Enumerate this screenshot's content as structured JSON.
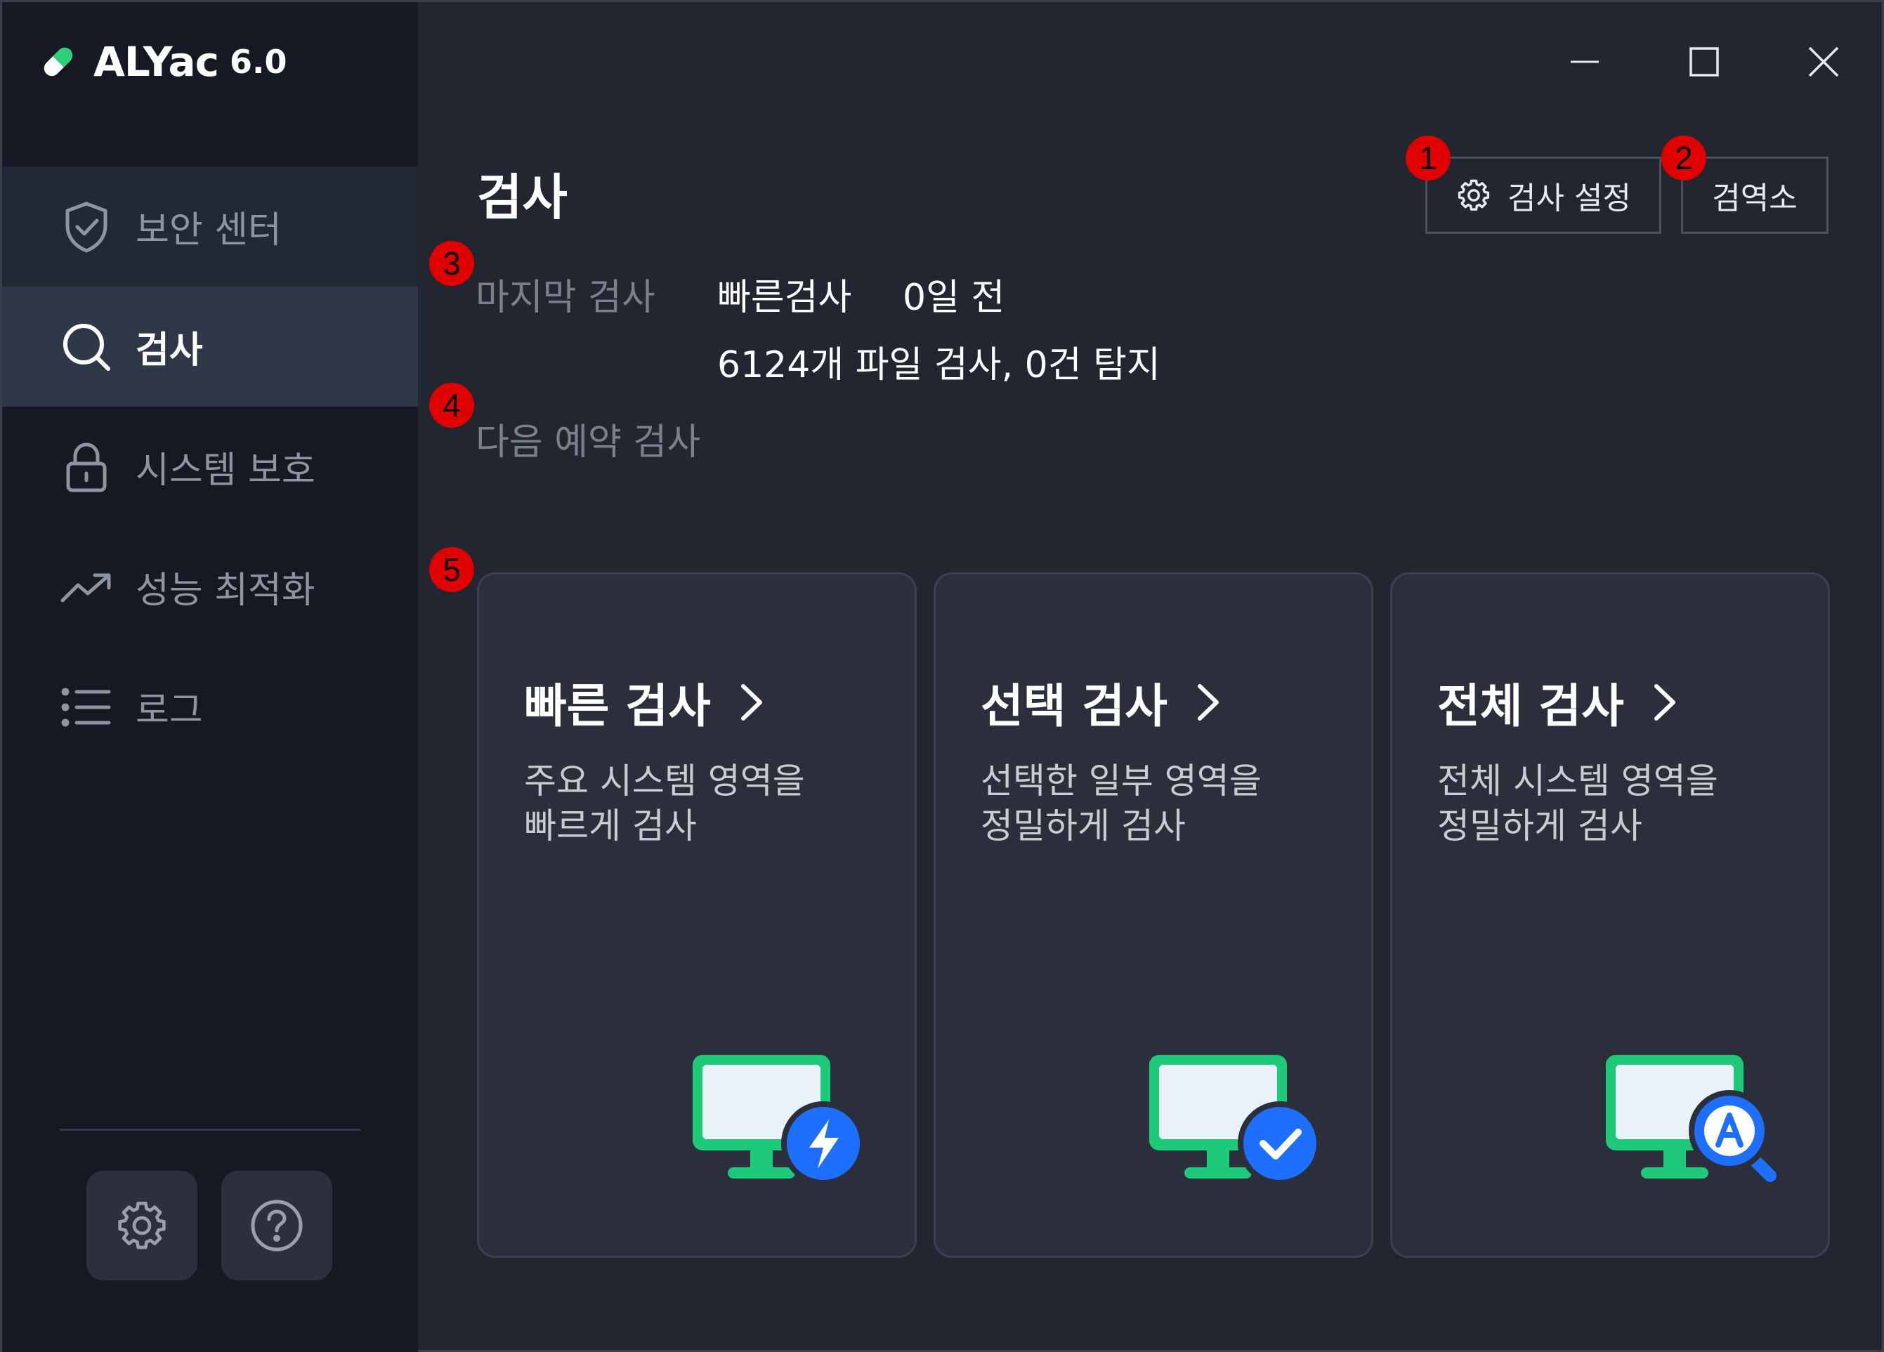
{
  "app": {
    "name": "ALYac",
    "version": "6.0"
  },
  "sidebar": {
    "items": [
      {
        "label": "보안 센터",
        "icon": "shield-check-icon"
      },
      {
        "label": "검사",
        "icon": "search-icon"
      },
      {
        "label": "시스템 보호",
        "icon": "lock-icon"
      },
      {
        "label": "성능 최적화",
        "icon": "trending-up-icon"
      },
      {
        "label": "로그",
        "icon": "list-icon"
      }
    ],
    "active_index": 1
  },
  "main": {
    "title": "검사",
    "buttons": {
      "scan_settings": "검사 설정",
      "quarantine": "검역소"
    },
    "last_scan": {
      "label": "마지막 검사",
      "type": "빠른검사",
      "when": "0일 전",
      "result": "6124개 파일 검사, 0건 탐지"
    },
    "next_scan": {
      "label": "다음 예약 검사"
    },
    "cards": [
      {
        "title": "빠른 검사",
        "desc1": "주요 시스템 영역을",
        "desc2": "빠르게 검사",
        "icon": "monitor-lightning-icon"
      },
      {
        "title": "선택 검사",
        "desc1": "선택한 일부 영역을",
        "desc2": "정밀하게 검사",
        "icon": "monitor-check-icon"
      },
      {
        "title": "전체 검사",
        "desc1": "전체 시스템 영역을",
        "desc2": "정밀하게 검사",
        "icon": "monitor-magnifier-icon"
      }
    ]
  },
  "annotations": [
    "1",
    "2",
    "3",
    "4",
    "5"
  ],
  "colors": {
    "sidebar_bg": "#151923",
    "main_bg": "#222631",
    "card_bg": "#2b2f3b",
    "accent_green": "#1ec97a",
    "accent_blue": "#1f6fff",
    "badge_red": "#e10000"
  }
}
